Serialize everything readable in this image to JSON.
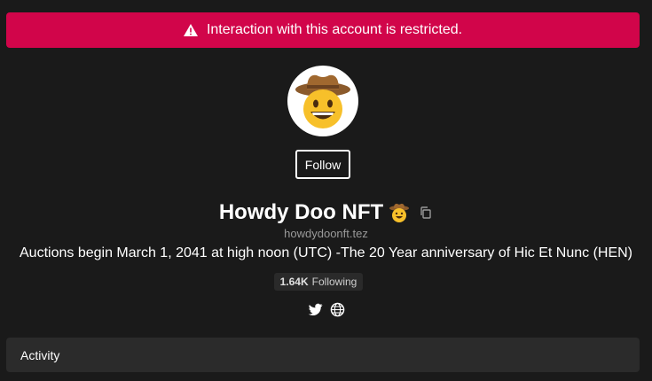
{
  "banner": {
    "text": "Interaction with this account is restricted.",
    "icon": "warning-icon",
    "color": "#d1054a"
  },
  "profile": {
    "avatar_icon": "cowboy-emoji-avatar",
    "follow_label": "Follow",
    "name": "Howdy Doo NFT",
    "name_emoji_icon": "cowboy-emoji-icon",
    "copy_icon": "copy-icon",
    "handle": "howdydoonft.tez",
    "bio": "Auctions begin March 1, 2041 at high noon (UTC) -The 20 Year anniversary of Hic Et Nunc (HEN)",
    "following_count": "1.64K",
    "following_label": "Following",
    "socials": [
      "twitter-icon",
      "globe-icon"
    ]
  },
  "tabs": {
    "activity_label": "Activity"
  },
  "colors": {
    "background": "#1a1a1a",
    "panel": "#2b2b2b",
    "handle_text": "#9a9a9a"
  }
}
